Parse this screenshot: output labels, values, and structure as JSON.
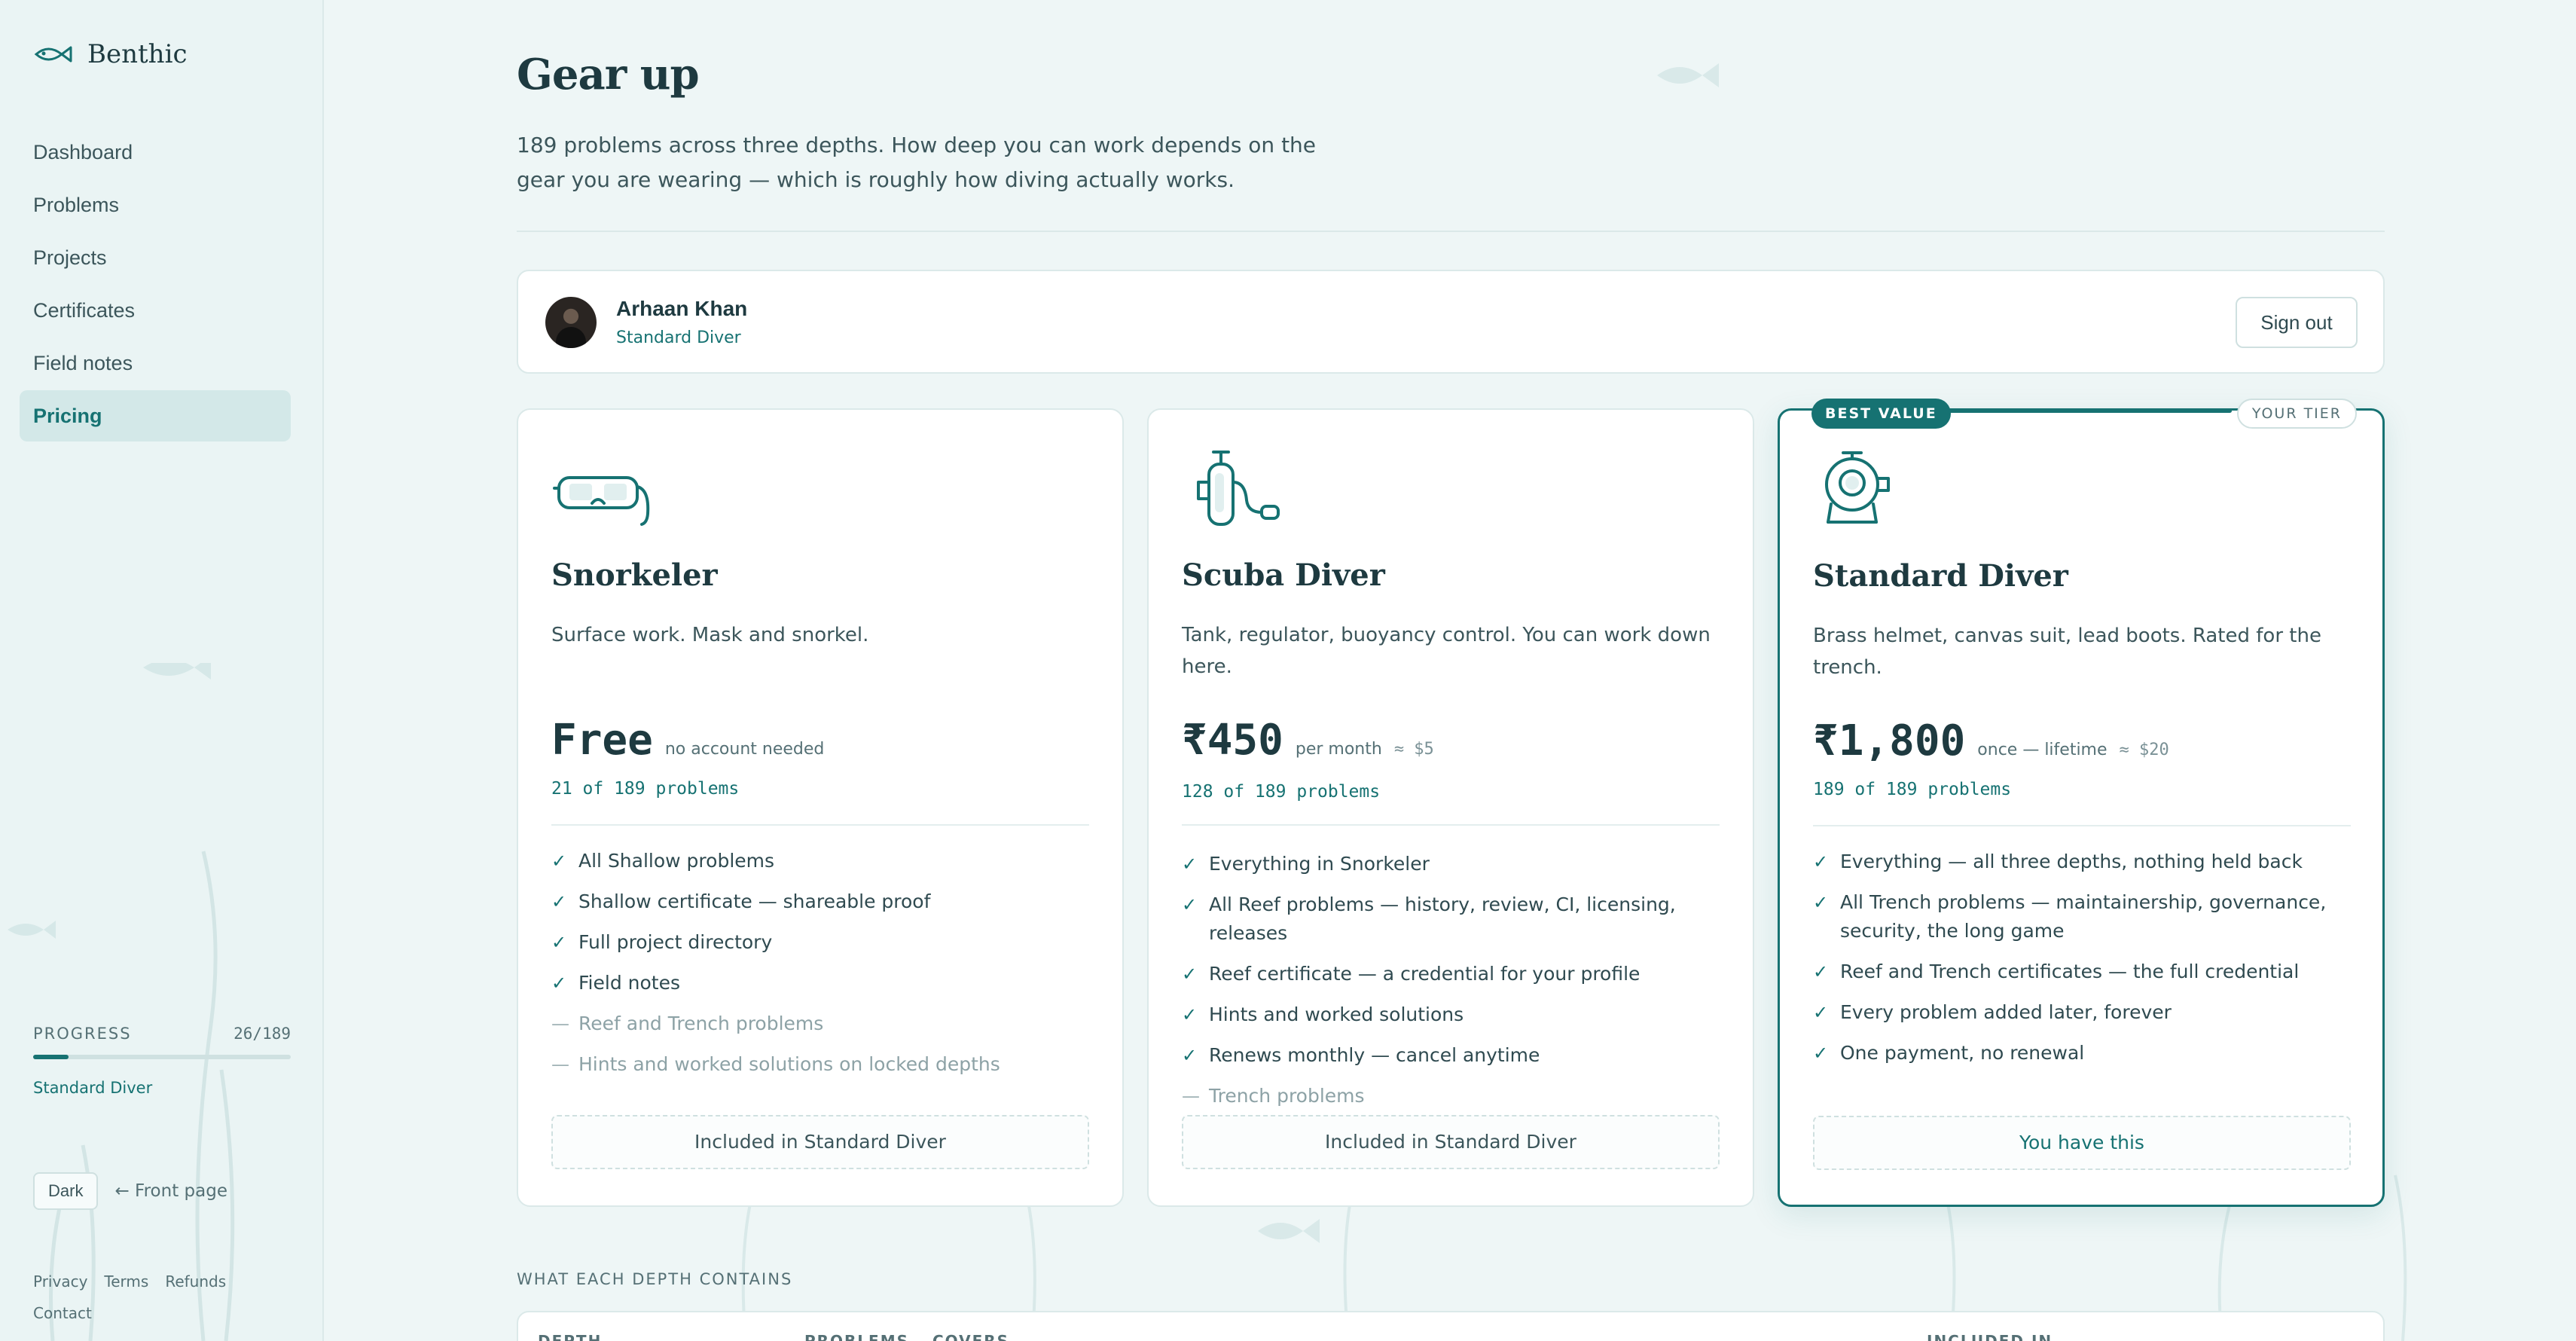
{
  "app": {
    "name": "Benthic"
  },
  "sidebar": {
    "items": [
      {
        "label": "Dashboard",
        "active": false
      },
      {
        "label": "Problems",
        "active": false
      },
      {
        "label": "Projects",
        "active": false
      },
      {
        "label": "Certificates",
        "active": false
      },
      {
        "label": "Field notes",
        "active": false
      },
      {
        "label": "Pricing",
        "active": true
      }
    ],
    "progress": {
      "label": "PROGRESS",
      "count": "26/189",
      "fraction": 0.1376,
      "tier": "Standard Diver"
    },
    "dark_label": "Dark",
    "front_page_label": "← Front page",
    "footer": {
      "privacy": "Privacy",
      "terms": "Terms",
      "refunds": "Refunds",
      "contact": "Contact"
    }
  },
  "page": {
    "title": "Gear up",
    "intro": "189 problems across three depths. How deep you can work depends on the gear you are wearing — which is roughly how diving actually works."
  },
  "user": {
    "name": "Arhaan Khan",
    "tier": "Standard Diver",
    "signout_label": "Sign out"
  },
  "plans": [
    {
      "name": "Snorkeler",
      "icon": "snorkel-mask-icon",
      "desc": "Surface work. Mask and snorkel.",
      "price": "Free",
      "period": "no account needed",
      "approx": "",
      "problems": "21 of 189 problems",
      "features": [
        {
          "text": "All Shallow problems",
          "included": true
        },
        {
          "text": "Shallow certificate — shareable proof",
          "included": true
        },
        {
          "text": "Full project directory",
          "included": true
        },
        {
          "text": "Field notes",
          "included": true
        },
        {
          "text": "Reef and Trench problems",
          "included": false
        },
        {
          "text": "Hints and worked solutions on locked depths",
          "included": false
        }
      ],
      "cta": "Included in Standard Diver"
    },
    {
      "name": "Scuba Diver",
      "icon": "scuba-tank-icon",
      "desc": "Tank, regulator, buoyancy control. You can work down here.",
      "price": "₹450",
      "period": "per month",
      "approx": "≈ $5",
      "problems": "128 of 189 problems",
      "features": [
        {
          "text": "Everything in Snorkeler",
          "included": true
        },
        {
          "text": "All Reef problems — history, review, CI, licensing, releases",
          "included": true
        },
        {
          "text": "Reef certificate — a credential for your profile",
          "included": true
        },
        {
          "text": "Hints and worked solutions",
          "included": true
        },
        {
          "text": "Renews monthly — cancel anytime",
          "included": true
        },
        {
          "text": "Trench problems",
          "included": false
        }
      ],
      "cta": "Included in Standard Diver"
    },
    {
      "name": "Standard Diver",
      "icon": "diving-helmet-icon",
      "desc": "Brass helmet, canvas suit, lead boots. Rated for the trench.",
      "price": "₹1,800",
      "period": "once — lifetime",
      "approx": "≈ $20",
      "problems": "189 of 189 problems",
      "badge_best": "BEST VALUE",
      "badge_tier": "YOUR TIER",
      "features": [
        {
          "text": "Everything — all three depths, nothing held back",
          "included": true
        },
        {
          "text": "All Trench problems — maintainership, governance, security, the long game",
          "included": true
        },
        {
          "text": "Reef and Trench certificates — the full credential",
          "included": true
        },
        {
          "text": "Every problem added later, forever",
          "included": true
        },
        {
          "text": "One payment, no renewal",
          "included": true
        }
      ],
      "cta": "You have this"
    }
  ],
  "depths": {
    "label": "WHAT EACH DEPTH CONTAINS",
    "headers": [
      "DEPTH",
      "PROBLEMS",
      "COVERS",
      "INCLUDED IN"
    ]
  },
  "colors": {
    "accent": "#167272",
    "background": "#eef6f6",
    "text": "#2f4a50"
  }
}
